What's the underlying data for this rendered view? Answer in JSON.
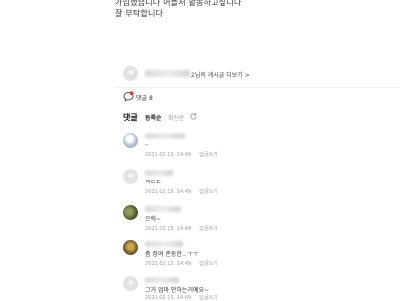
{
  "post": {
    "line1": "가입했습니다 어플서 활동하고싶니다",
    "line2": "잘 부탁합니다"
  },
  "author": {
    "name_suffix": "2님의 게시글 더보기 >"
  },
  "stats": {
    "comment_label": "댓글 8"
  },
  "comments_header": {
    "title": "댓글",
    "sort_order": "등록순",
    "sort_latest": "최신순"
  },
  "comments": [
    {
      "text": "..",
      "date": "2021.02.15. 14:49",
      "reply": "답글쓰기"
    },
    {
      "text": "ㅋㄷㄷ",
      "date": "2021.02.15. 14:49",
      "reply": "답글쓰기"
    },
    {
      "text": "으헉~",
      "date": "2021.02.15. 14:49",
      "reply": "답글쓰기"
    },
    {
      "text": "좀 정여 존둥한.. ㅜㅜ",
      "date": "2021.02.15. 14:49",
      "reply": "답글쓰기"
    },
    {
      "text": "그거 엄마 안하는거예요~",
      "date": "2021.02.15. 14:49",
      "reply": "답글쓰기"
    }
  ],
  "colors": {
    "badge_red": "#e33e3e",
    "refresh_icon": "#9a9a9a"
  }
}
